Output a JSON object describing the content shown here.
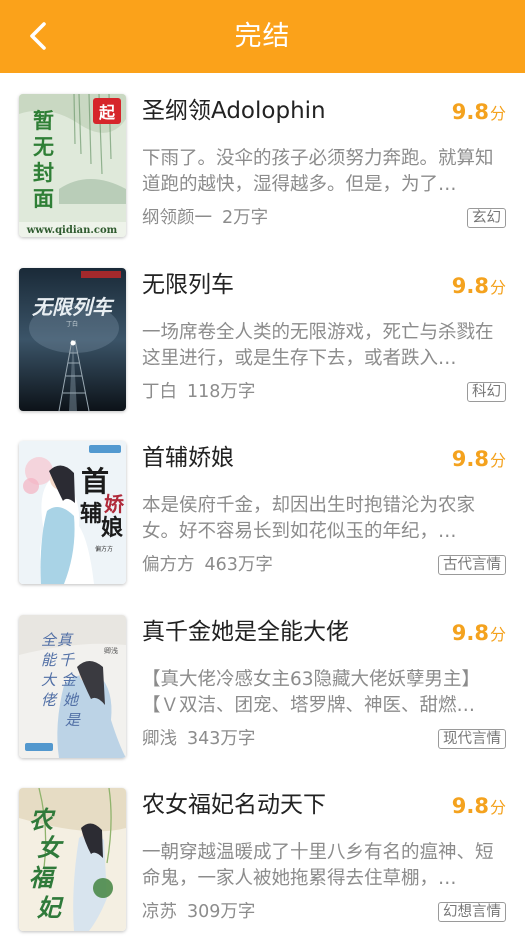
{
  "header": {
    "title": "完结",
    "back_icon": "chevron-left-icon",
    "color": "#fba21a"
  },
  "accent_color": "#f4a21e",
  "books": [
    {
      "title": "圣纲领Adolophin",
      "score": "9.8",
      "score_unit": "分",
      "description": "下雨了。没伞的孩子必须努力奔跑。就算知道跑的越快，湿得越多。但是，为了…",
      "author": "纲领颜一",
      "words": "2万字",
      "tag": "玄幻",
      "cover_text": "暂无封面",
      "cover_url": "www.qidian.com"
    },
    {
      "title": "无限列车",
      "score": "9.8",
      "score_unit": "分",
      "description": "一场席卷全人类的无限游戏，死亡与杀戮在这里进行，或是生存下去，或者跌入…",
      "author": "丁白",
      "words": "118万字",
      "tag": "科幻",
      "cover_text": "无限列车"
    },
    {
      "title": "首辅娇娘",
      "score": "9.8",
      "score_unit": "分",
      "description": "本是侯府千金，却因出生时抱错沦为农家女。好不容易长到如花似玉的年纪，…",
      "author": "偏方方",
      "words": "463万字",
      "tag": "古代言情",
      "cover_text": "首辅娇娘"
    },
    {
      "title": "真千金她是全能大佬",
      "score": "9.8",
      "score_unit": "分",
      "description": "【真大佬冷感女主63隐藏大佬妖孽男主】【Ｖ双洁、团宠、塔罗牌、神医、甜燃…",
      "author": "卿浅",
      "words": "343万字",
      "tag": "现代言情",
      "cover_text": "真千金她是全能大佬"
    },
    {
      "title": "农女福妃名动天下",
      "score": "9.8",
      "score_unit": "分",
      "description": "一朝穿越温暖成了十里八乡有名的瘟神、短命鬼，一家人被她拖累得去住草棚，…",
      "author": "凉苏",
      "words": "309万字",
      "tag": "幻想言情",
      "cover_text": "农女福妃"
    }
  ]
}
